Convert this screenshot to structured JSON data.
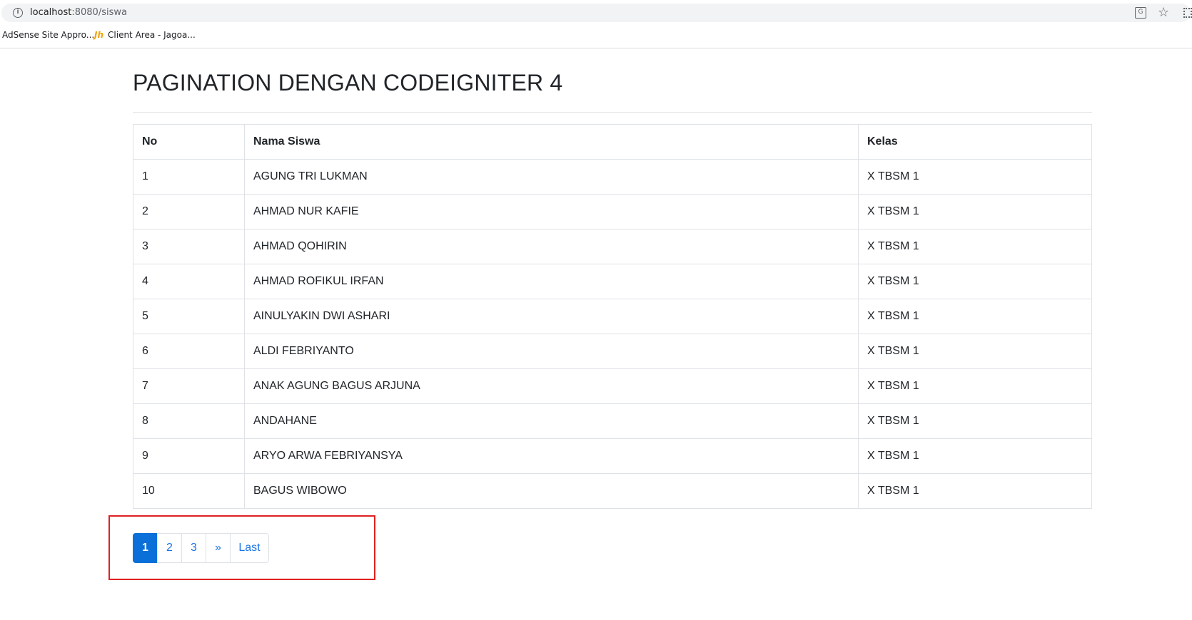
{
  "browser": {
    "url_host": "localhost",
    "url_rest": ":8080/siswa",
    "bookmarks": [
      {
        "label": "AdSense Site Appro..."
      },
      {
        "icon_text": "Jh",
        "label": "Client Area - Jagoa..."
      }
    ]
  },
  "page": {
    "title": "PAGINATION DENGAN CODEIGNITER 4"
  },
  "table": {
    "headers": [
      "No",
      "Nama Siswa",
      "Kelas"
    ],
    "rows": [
      [
        "1",
        "AGUNG TRI LUKMAN",
        "X TBSM 1"
      ],
      [
        "2",
        "AHMAD NUR KAFIE",
        "X TBSM 1"
      ],
      [
        "3",
        "AHMAD QOHIRIN",
        "X TBSM 1"
      ],
      [
        "4",
        "AHMAD ROFIKUL IRFAN",
        "X TBSM 1"
      ],
      [
        "5",
        "AINULYAKIN DWI ASHARI",
        "X TBSM 1"
      ],
      [
        "6",
        "ALDI FEBRIYANTO",
        "X TBSM 1"
      ],
      [
        "7",
        "ANAK AGUNG BAGUS ARJUNA",
        "X TBSM 1"
      ],
      [
        "8",
        "ANDAHANE",
        "X TBSM 1"
      ],
      [
        "9",
        "ARYO ARWA FEBRIYANSYA",
        "X TBSM 1"
      ],
      [
        "10",
        "BAGUS WIBOWO",
        "X TBSM 1"
      ]
    ]
  },
  "pagination": {
    "items": [
      {
        "label": "1",
        "active": true
      },
      {
        "label": "2",
        "active": false
      },
      {
        "label": "3",
        "active": false
      },
      {
        "label": "»",
        "active": false
      },
      {
        "label": "Last",
        "active": false
      }
    ]
  },
  "colors": {
    "active_page": "#0a6fd8",
    "link": "#1a73e8",
    "highlight_box": "#e02020"
  },
  "icons": [
    "info-icon",
    "translate-icon",
    "star-icon",
    "qr-icon"
  ]
}
